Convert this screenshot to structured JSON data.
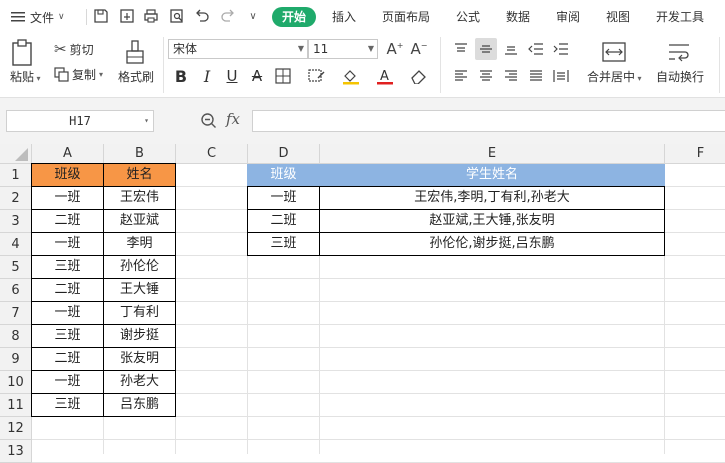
{
  "toolbar": {
    "file_menu": "文件",
    "tabs": [
      "开始",
      "插入",
      "页面布局",
      "公式",
      "数据",
      "审阅",
      "视图",
      "开发工具"
    ],
    "active_tab": "开始"
  },
  "ribbon": {
    "paste": "粘贴",
    "cut": "剪切",
    "copy": "复制",
    "format_painter": "格式刷",
    "font_name": "宋体",
    "font_size": "11",
    "merge_center": "合并居中",
    "wrap_text": "自动换行"
  },
  "formula_bar": {
    "name_box": "H17",
    "fx": "fx",
    "value": ""
  },
  "sheet": {
    "columns": [
      "A",
      "B",
      "C",
      "D",
      "E",
      "F"
    ],
    "rows": [
      "1",
      "2",
      "3",
      "4",
      "5",
      "6",
      "7",
      "8",
      "9",
      "10",
      "11",
      "12",
      "13"
    ],
    "left_table": {
      "headers": [
        "班级",
        "姓名"
      ],
      "rows": [
        [
          "一班",
          "王宏伟"
        ],
        [
          "二班",
          "赵亚斌"
        ],
        [
          "一班",
          "李明"
        ],
        [
          "三班",
          "孙伦伦"
        ],
        [
          "二班",
          "王大锤"
        ],
        [
          "一班",
          "丁有利"
        ],
        [
          "三班",
          "谢步挺"
        ],
        [
          "二班",
          "张友明"
        ],
        [
          "一班",
          "孙老大"
        ],
        [
          "三班",
          "吕东鹏"
        ]
      ]
    },
    "right_table": {
      "headers": [
        "班级",
        "学生姓名"
      ],
      "rows": [
        [
          "一班",
          "王宏伟,李明,丁有利,孙老大"
        ],
        [
          "二班",
          "赵亚斌,王大锤,张友明"
        ],
        [
          "三班",
          "孙伦伦,谢步挺,吕东鹏"
        ]
      ]
    }
  },
  "colors": {
    "active_tab": "#1faa6b",
    "left_header_fill": "#f79646",
    "right_header_fill": "#8db4e2"
  }
}
